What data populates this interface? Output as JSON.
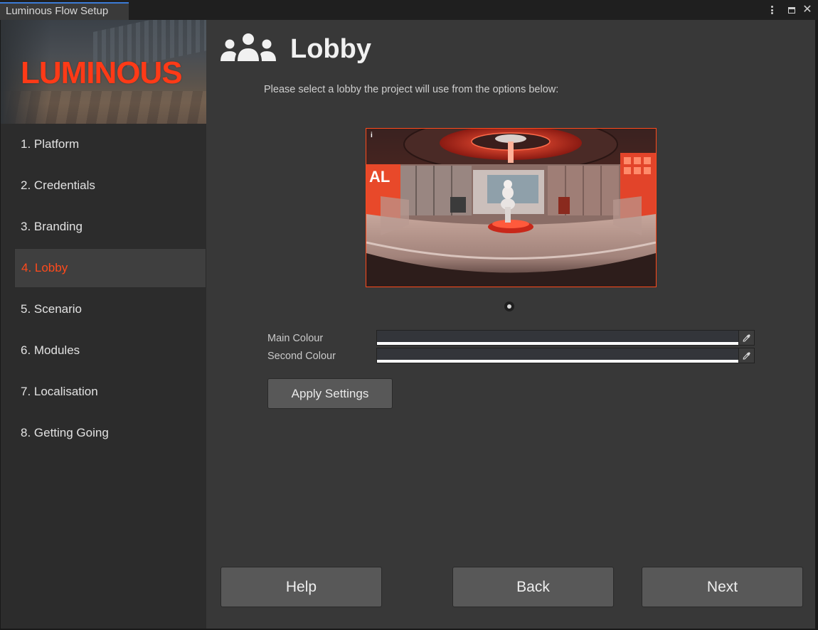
{
  "window": {
    "tab_title": "Luminous Flow Setup"
  },
  "sidebar": {
    "logo_text": "LUMINOUS",
    "items": [
      {
        "label": "1. Platform"
      },
      {
        "label": "2. Credentials"
      },
      {
        "label": "3. Branding"
      },
      {
        "label": "4. Lobby",
        "active": true
      },
      {
        "label": "5. Scenario"
      },
      {
        "label": "6. Modules"
      },
      {
        "label": "7. Localisation"
      },
      {
        "label": "8. Getting Going"
      }
    ]
  },
  "main": {
    "header_icon": "group-users-icon",
    "title": "Lobby",
    "instruction": "Please select a lobby the project will use from the options below:",
    "preview_info": "i",
    "fields": {
      "main_colour_label": "Main Colour",
      "second_colour_label": "Second Colour"
    },
    "apply_label": "Apply Settings"
  },
  "footer": {
    "help_label": "Help",
    "back_label": "Back",
    "next_label": "Next"
  },
  "colors": {
    "accent": "#ff4a1c",
    "logo": "#ff3a17",
    "panel": "#383838",
    "sidebar": "#2c2c2c",
    "button": "#585858"
  }
}
